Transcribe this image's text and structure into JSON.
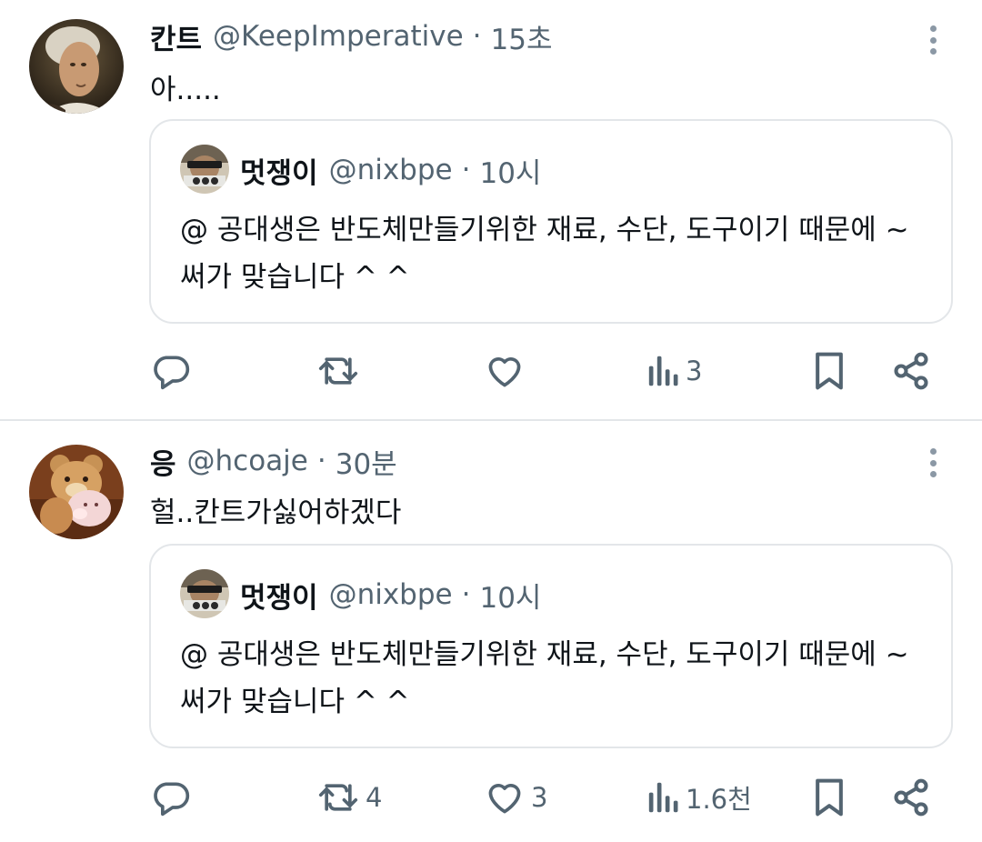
{
  "tweets": [
    {
      "author_name": "칸트",
      "handle": "@KeepImperative",
      "separator": "·",
      "time": "15초",
      "text": "아.....",
      "avatar_icon": "portrait-avatar-icon",
      "quote": {
        "author_name": "멋쟁이",
        "handle": "@nixbpe",
        "separator": "·",
        "time": "10시",
        "text": "@ 공대생은 반도체만들기위한 재료, 수단, 도구이기 때문에 ~써가 맞습니다 ^ ^"
      },
      "actions": {
        "reply_count": "",
        "retweet_count": "",
        "like_count": "",
        "views_count": "3"
      }
    },
    {
      "author_name": "응",
      "handle": "@hcoaje",
      "separator": "·",
      "time": "30분",
      "text": "헐..칸트가싫어하겠다",
      "avatar_icon": "teddy-bear-avatar-icon",
      "quote": {
        "author_name": "멋쟁이",
        "handle": "@nixbpe",
        "separator": "·",
        "time": "10시",
        "text": "@ 공대생은 반도체만들기위한 재료, 수단, 도구이기 때문에 ~써가 맞습니다 ^ ^"
      },
      "actions": {
        "reply_count": "",
        "retweet_count": "4",
        "like_count": "3",
        "views_count": "1.6천"
      }
    }
  ],
  "colors": {
    "text_primary": "#0f1419",
    "text_secondary": "#536471",
    "border": "#e3e6e9"
  }
}
